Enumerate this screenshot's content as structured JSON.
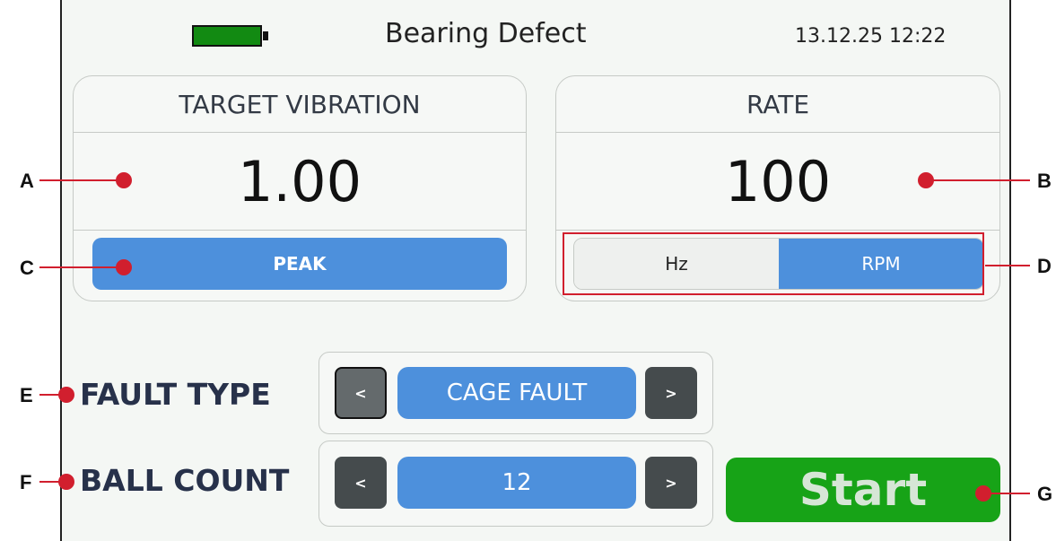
{
  "header": {
    "title": "Bearing Defect",
    "datetime": "13.12.25 12:22",
    "battery_icon": "battery-full-icon"
  },
  "target_vibration": {
    "label": "TARGET VIBRATION",
    "value": "1.00",
    "mode": "PEAK"
  },
  "rate": {
    "label": "RATE",
    "value": "100",
    "units": [
      "Hz",
      "RPM"
    ],
    "selected_unit": "RPM"
  },
  "fault_type": {
    "label": "FAULT TYPE",
    "value": "CAGE FAULT",
    "prev": "<",
    "next": ">"
  },
  "ball_count": {
    "label": "BALL COUNT",
    "value": "12",
    "prev": "<",
    "next": ">"
  },
  "start_label": "Start",
  "callouts": {
    "a": "A",
    "b": "B",
    "c": "C",
    "d": "D",
    "e": "E",
    "f": "F",
    "g": "G"
  },
  "colors": {
    "accent_blue": "#4d90dc",
    "start_green": "#17a317",
    "battery_green": "#128a12",
    "callout_red": "#d11f2e"
  }
}
